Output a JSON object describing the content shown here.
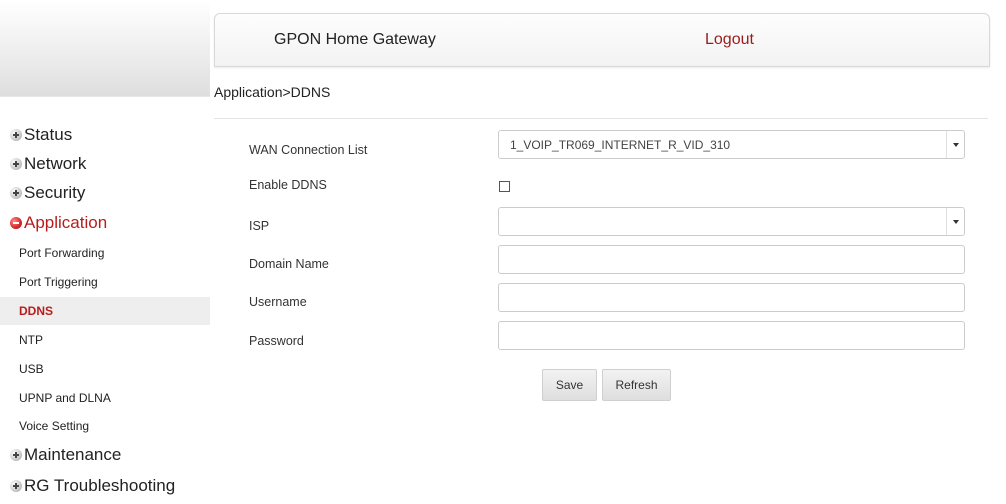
{
  "header": {
    "title": "GPON Home Gateway",
    "logout": "Logout"
  },
  "breadcrumb": "Application>DDNS",
  "sidebar": {
    "sections": [
      {
        "label": "Status",
        "state": "collapsed"
      },
      {
        "label": "Network",
        "state": "collapsed"
      },
      {
        "label": "Security",
        "state": "collapsed"
      },
      {
        "label": "Application",
        "state": "expanded"
      }
    ],
    "sub_items": [
      {
        "label": "Port Forwarding"
      },
      {
        "label": "Port Triggering"
      },
      {
        "label": "DDNS",
        "selected": true
      },
      {
        "label": "NTP"
      },
      {
        "label": "USB"
      },
      {
        "label": "UPNP and DLNA"
      },
      {
        "label": "Voice Setting"
      }
    ],
    "bottom_sections": [
      {
        "label": "Maintenance",
        "state": "collapsed"
      },
      {
        "label": "RG Troubleshooting",
        "state": "collapsed"
      }
    ]
  },
  "form": {
    "wan_connection_list": {
      "label": "WAN Connection List",
      "value": "1_VOIP_TR069_INTERNET_R_VID_310"
    },
    "enable_ddns": {
      "label": "Enable DDNS",
      "checked": false
    },
    "isp": {
      "label": "ISP",
      "value": ""
    },
    "domain_name": {
      "label": "Domain Name",
      "value": ""
    },
    "username": {
      "label": "Username",
      "value": ""
    },
    "password": {
      "label": "Password",
      "value": ""
    }
  },
  "buttons": {
    "save": "Save",
    "refresh": "Refresh"
  },
  "colors": {
    "active_nav": "#b81d1d",
    "logout": "#9b1c1c",
    "selected_bg": "#eeeeee"
  }
}
